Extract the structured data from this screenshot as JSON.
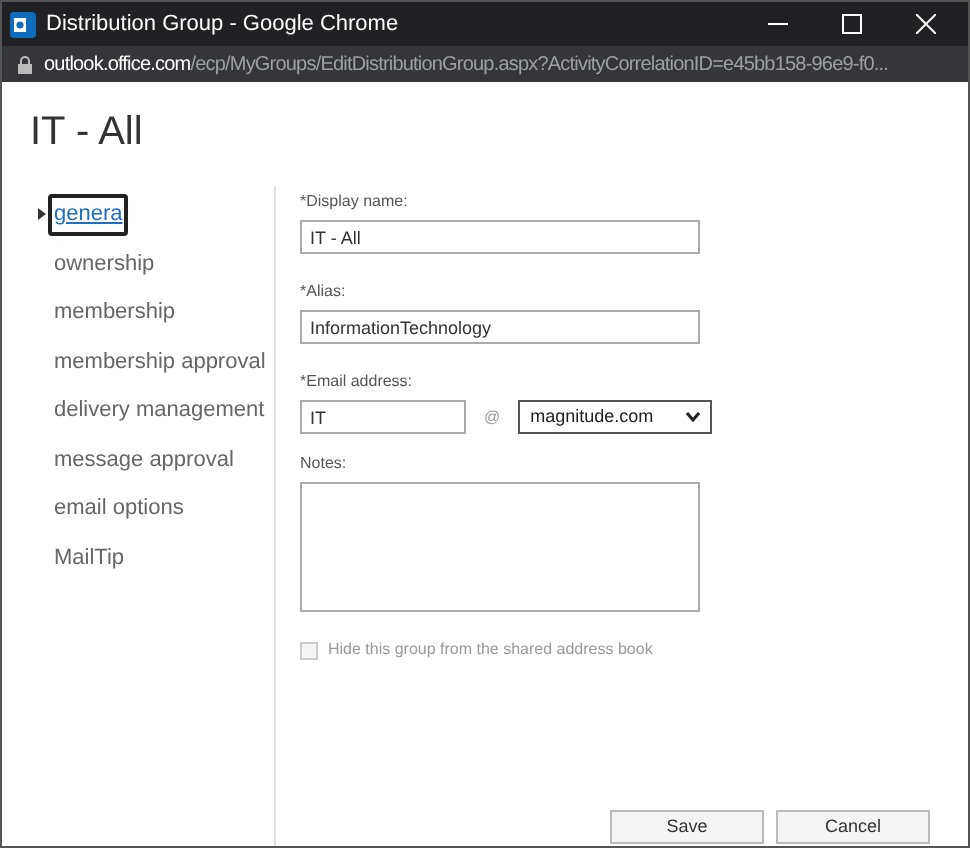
{
  "window": {
    "title": "Distribution Group - Google Chrome"
  },
  "address_bar": {
    "host": "outlook.office.com",
    "path": "/ecp/MyGroups/EditDistributionGroup.aspx?ActivityCorrelationID=e45bb158-96e9-f0..."
  },
  "page_title": "IT - All",
  "nav": [
    {
      "label": "genera",
      "selected": true
    },
    {
      "label": "ownership",
      "selected": false
    },
    {
      "label": "membership",
      "selected": false
    },
    {
      "label": "membership approval",
      "selected": false
    },
    {
      "label": "delivery management",
      "selected": false
    },
    {
      "label": "message approval",
      "selected": false
    },
    {
      "label": "email options",
      "selected": false
    },
    {
      "label": "MailTip",
      "selected": false
    }
  ],
  "display_name": {
    "label": "*Display name:",
    "value": "IT - All"
  },
  "alias": {
    "label": "*Alias:",
    "value": "InformationTechnology"
  },
  "email": {
    "label": "*Email address:",
    "value": "IT",
    "at": "@",
    "domain": "magnitude.com"
  },
  "notes": {
    "label": "Notes:"
  },
  "hide_checkbox": {
    "label": "Hide this group from the shared address book",
    "checked": false,
    "disabled": true
  },
  "buttons": [
    "Save",
    "Cancel"
  ]
}
